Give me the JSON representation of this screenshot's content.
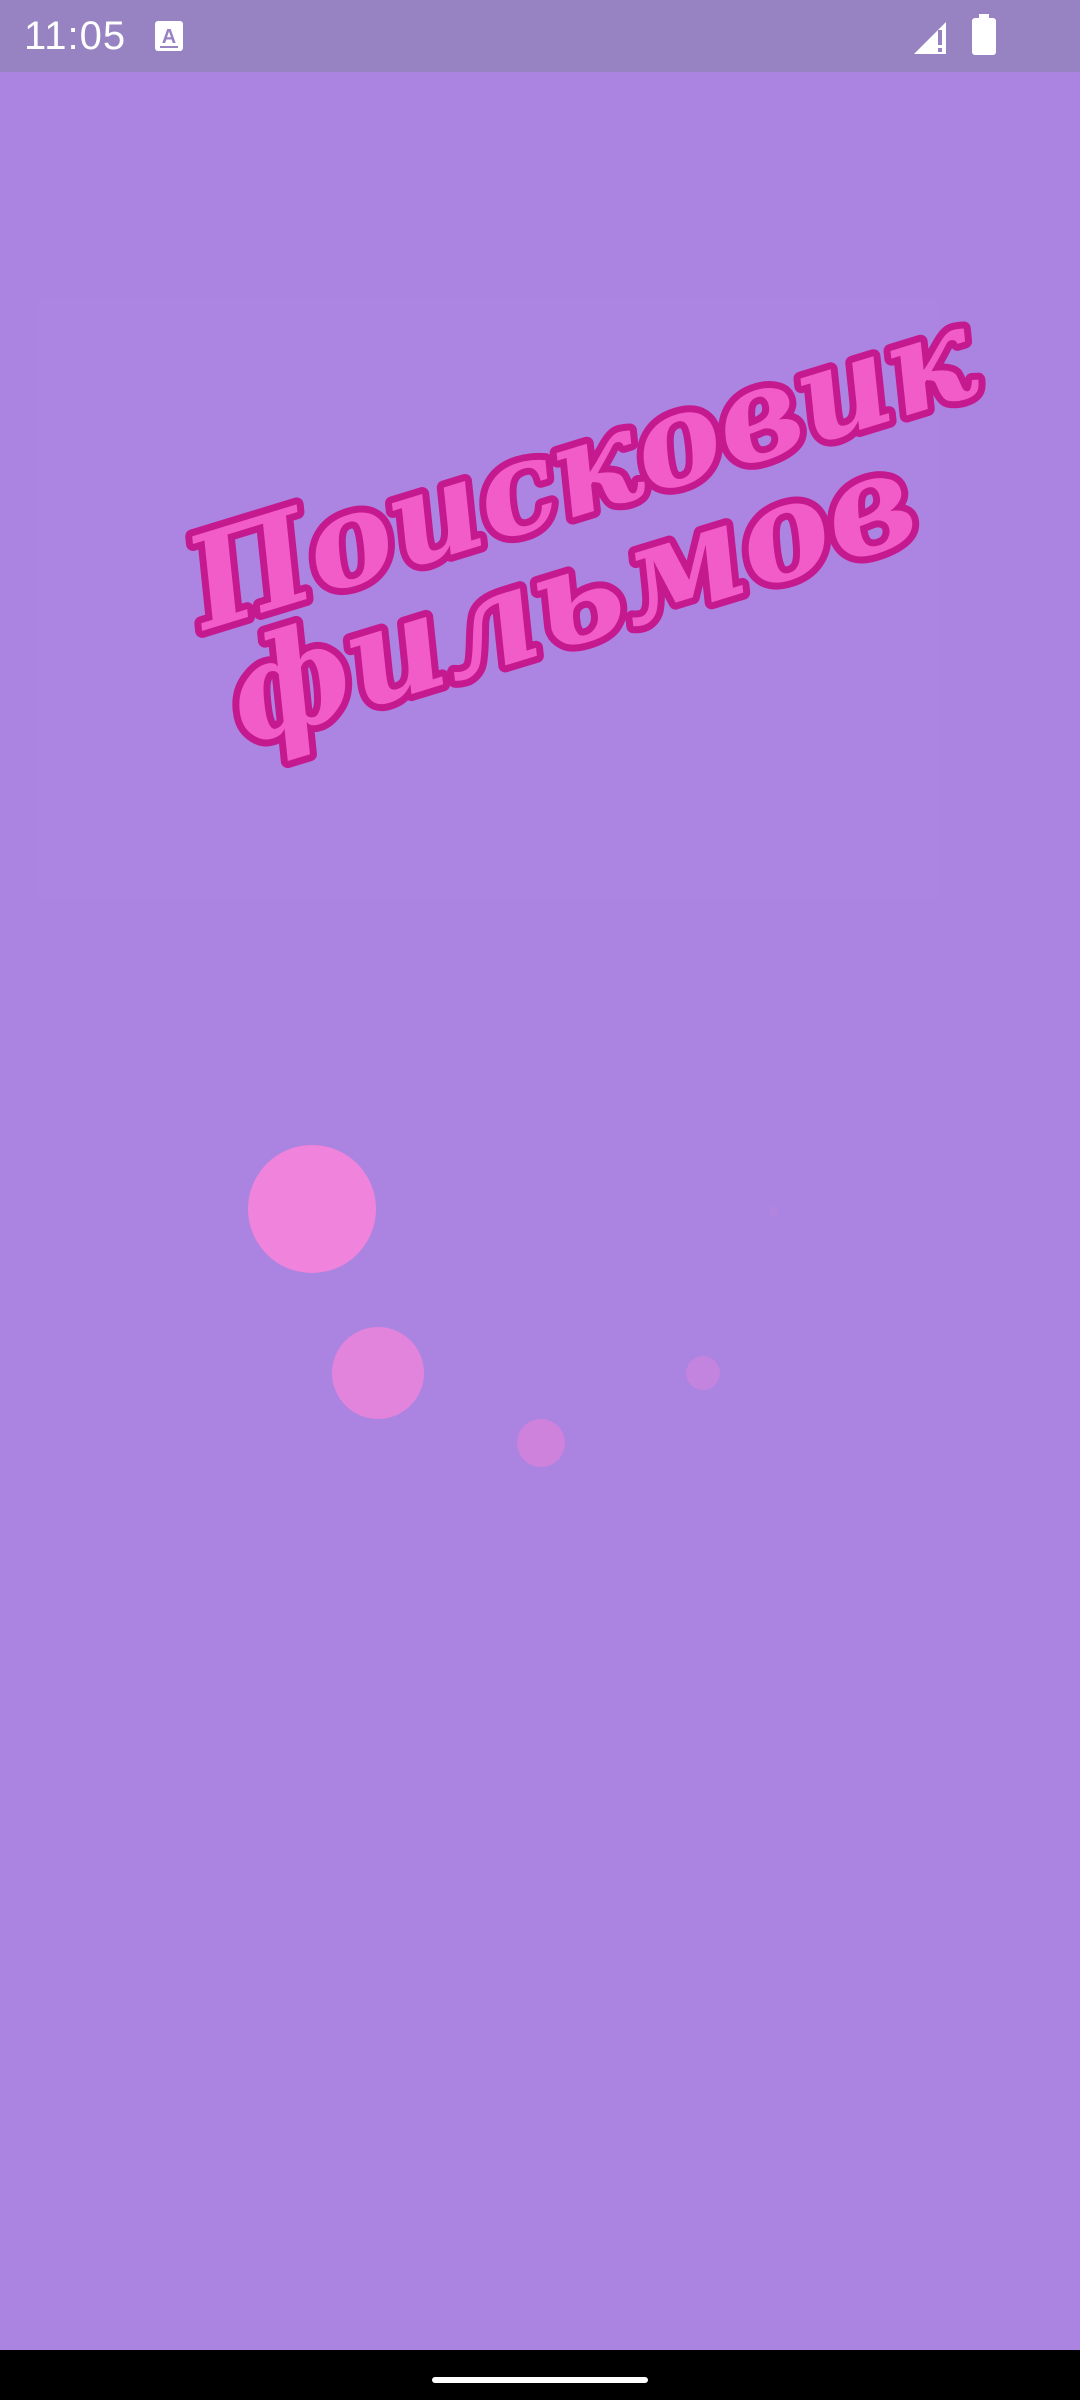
{
  "status_bar": {
    "time": "11:05",
    "icons": [
      "keyboard-a-icon",
      "signal-icon",
      "battery-icon"
    ]
  },
  "logo": {
    "line1": "Поисковик",
    "line2": "фильмов",
    "fill_color": "#f25cc8",
    "outline_color": "#c51a8f"
  },
  "colors": {
    "background": "#ab83e1",
    "status_bar": "#9783c2",
    "bubbles": [
      "#f083dc",
      "#e384dc",
      "#ce82dc",
      "#c284de",
      "#b184df"
    ]
  },
  "loading_indicator": {
    "icon": "loading-bubbles-icon"
  },
  "navigation": {
    "icon": "gesture-handle-icon"
  }
}
